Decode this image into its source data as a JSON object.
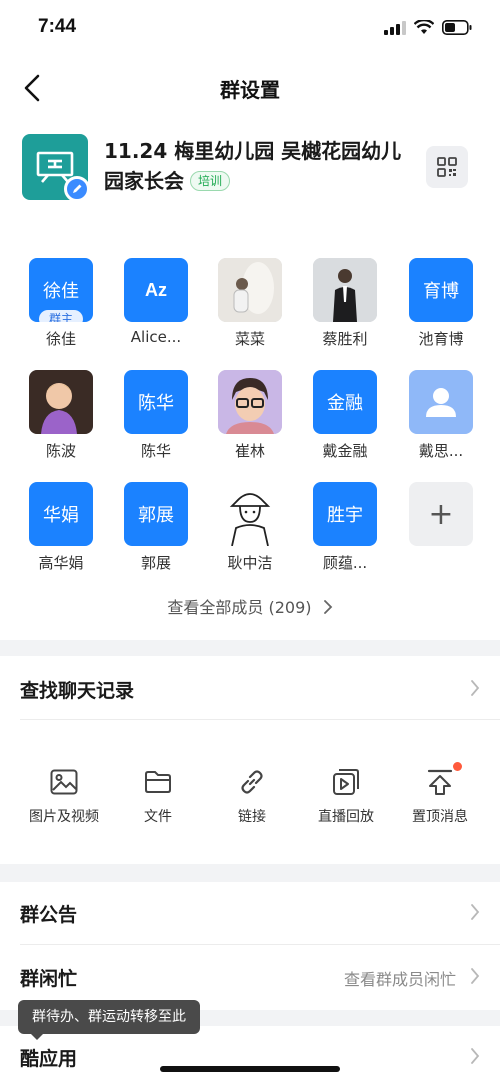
{
  "status": {
    "time": "7:44"
  },
  "nav": {
    "title": "群设置"
  },
  "group": {
    "name": "11.24 梅里幼儿园 吴樾花园幼儿园家长会",
    "tag": "培训"
  },
  "members": [
    {
      "avatar_text": "徐佳",
      "name": "徐佳",
      "badge": "群主"
    },
    {
      "avatar_text": "Az",
      "name": "Alice..."
    },
    {
      "avatar_text": "",
      "name": "菜菜"
    },
    {
      "avatar_text": "",
      "name": "蔡胜利"
    },
    {
      "avatar_text": "育博",
      "name": "池育博"
    },
    {
      "avatar_text": "",
      "name": "陈波"
    },
    {
      "avatar_text": "陈华",
      "name": "陈华"
    },
    {
      "avatar_text": "",
      "name": "崔林"
    },
    {
      "avatar_text": "金融",
      "name": "戴金融"
    },
    {
      "avatar_text": "",
      "name": "戴思..."
    },
    {
      "avatar_text": "华娟",
      "name": "高华娟"
    },
    {
      "avatar_text": "郭展",
      "name": "郭展"
    },
    {
      "avatar_text": "",
      "name": "耿中洁"
    },
    {
      "avatar_text": "胜宇",
      "name": "顾蕴..."
    },
    {
      "avatar_text": "+",
      "name": ""
    }
  ],
  "view_all": {
    "label": "查看全部成员 (209)"
  },
  "search_chat": {
    "label": "查找聊天记录"
  },
  "actions": [
    {
      "label": "图片及视频",
      "icon": "image-icon"
    },
    {
      "label": "文件",
      "icon": "folder-icon"
    },
    {
      "label": "链接",
      "icon": "link-icon"
    },
    {
      "label": "直播回放",
      "icon": "replay-icon"
    },
    {
      "label": "置顶消息",
      "icon": "pin-top-icon"
    }
  ],
  "announcement": {
    "label": "群公告"
  },
  "busy_status": {
    "label": "群闲忙",
    "hint": "查看群成员闲忙"
  },
  "cool_apps": {
    "label": "酷应用"
  },
  "tooltip": {
    "text": "群待办、群运动转移至此"
  },
  "colors": {
    "accent": "#1b82ff",
    "group_avatar": "#1e9e99",
    "tag_green": "#1faa52",
    "dot_red": "#ff5a3c"
  }
}
